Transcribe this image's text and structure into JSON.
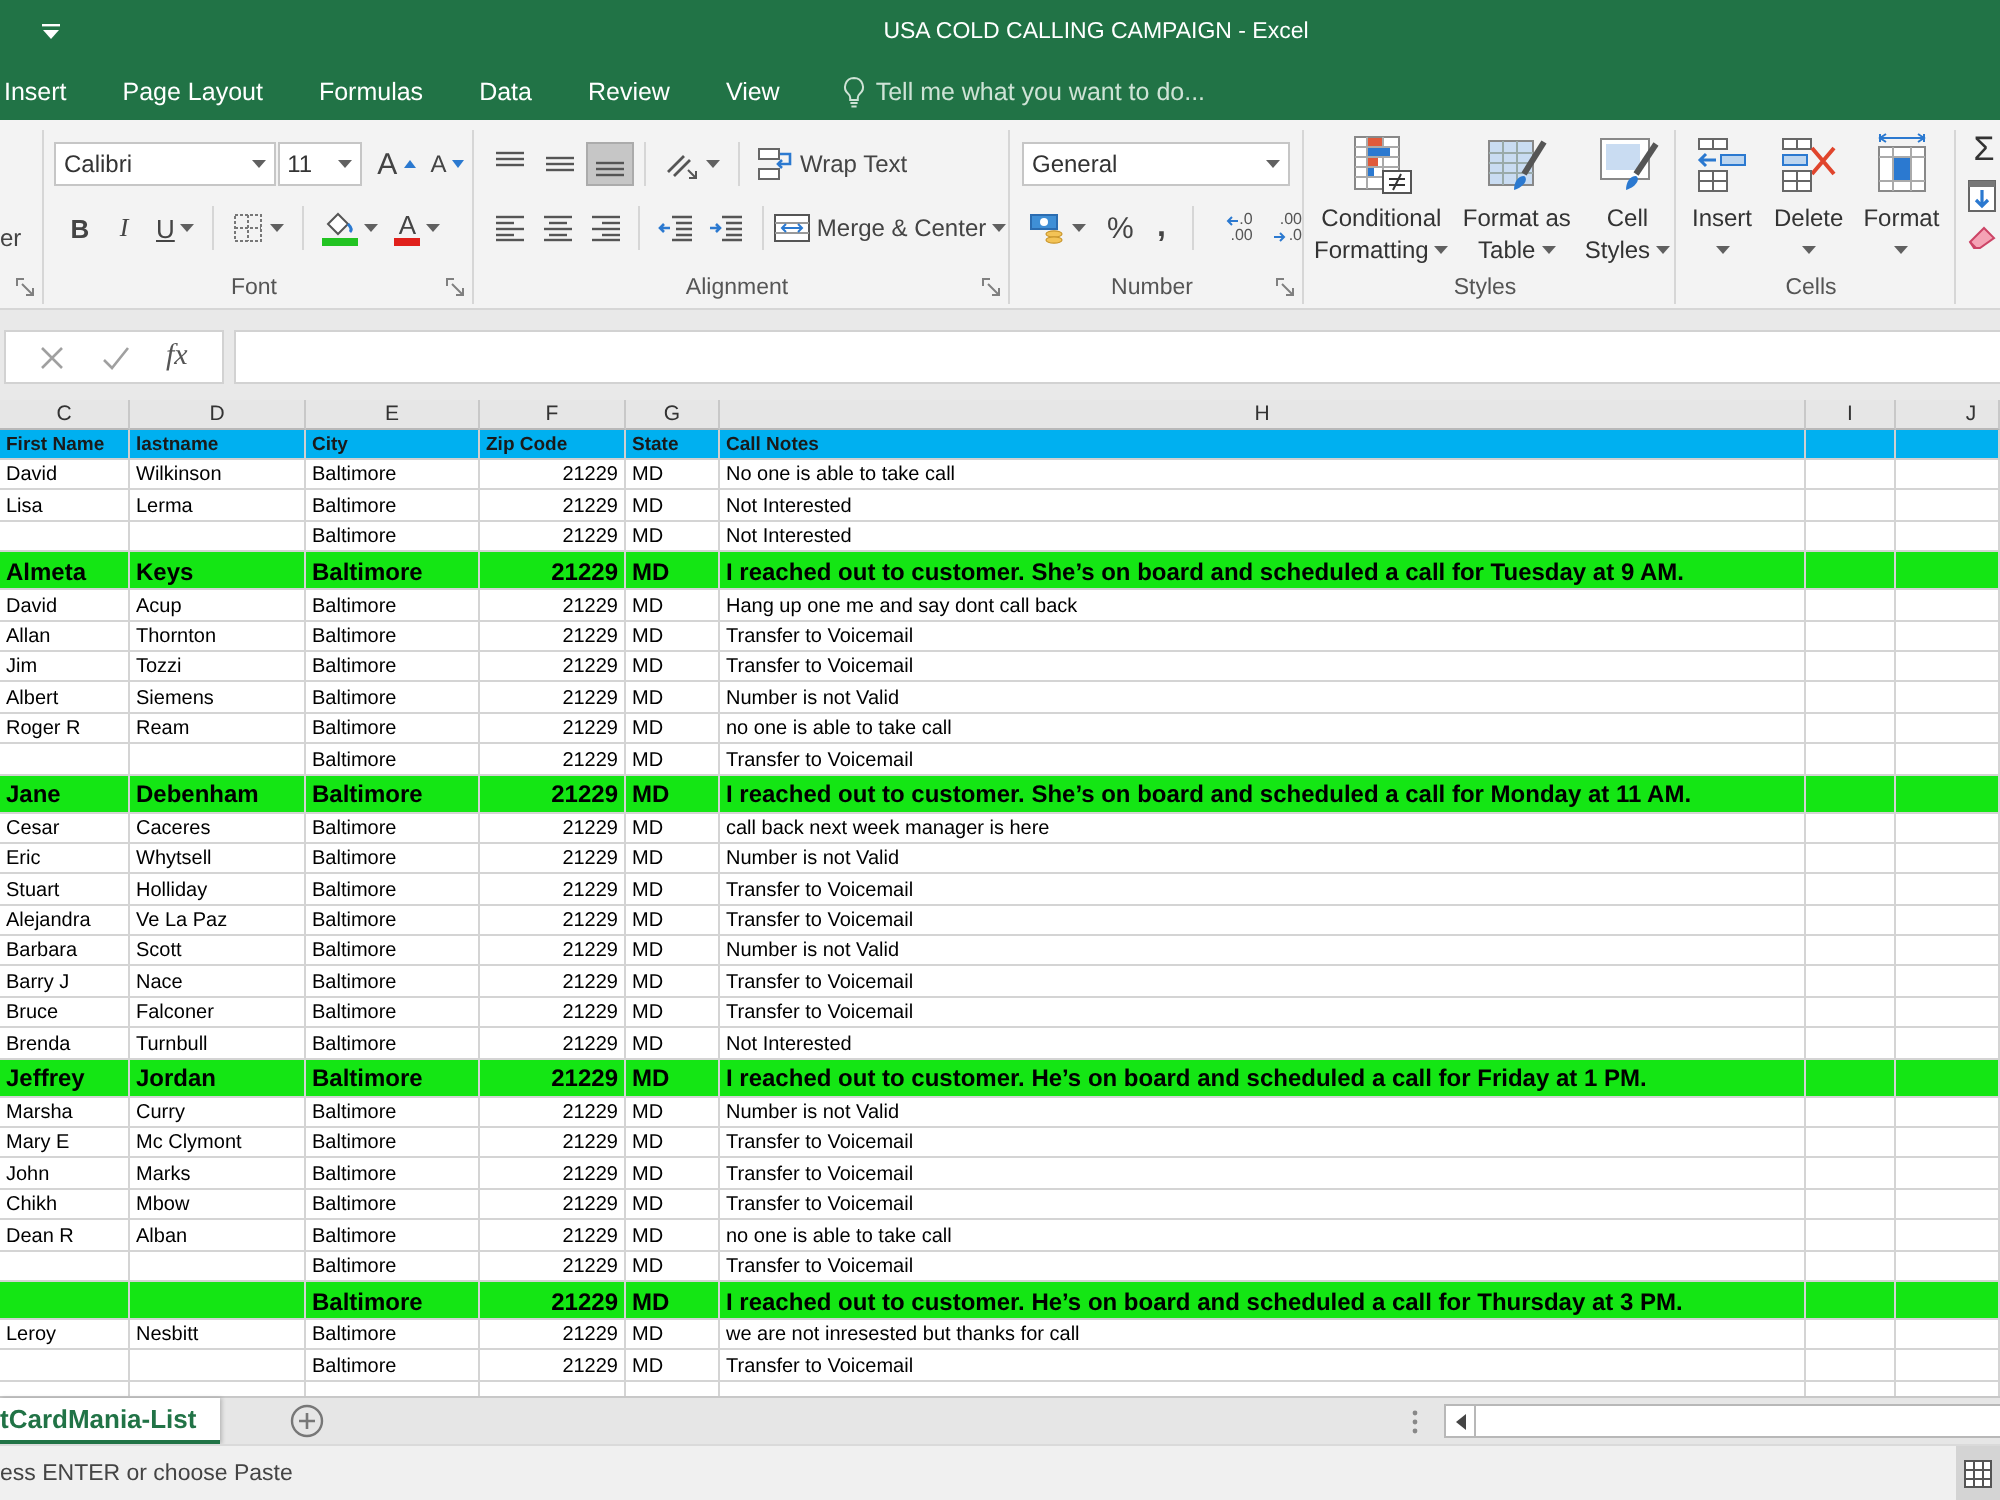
{
  "window": {
    "title": "USA COLD CALLING CAMPAIGN - Excel"
  },
  "menu_tabs": [
    {
      "label": "Insert"
    },
    {
      "label": "Page Layout"
    },
    {
      "label": "Formulas"
    },
    {
      "label": "Data"
    },
    {
      "label": "Review"
    },
    {
      "label": "View"
    }
  ],
  "tell_me": {
    "placeholder": "Tell me what you want to do..."
  },
  "ribbon": {
    "clipboard": {
      "label_fragment": "er"
    },
    "font": {
      "label": "Font",
      "font_name": "Calibri",
      "font_size": "11",
      "grow": "A",
      "shrink": "A",
      "styles": [
        {
          "kind": "bold",
          "label": "B"
        },
        {
          "kind": "italic",
          "label": "I"
        },
        {
          "kind": "underline",
          "label": "U"
        }
      ],
      "font_color": "A"
    },
    "alignment": {
      "label": "Alignment",
      "vertical": [
        {
          "kind": "top",
          "selected": false
        },
        {
          "kind": "middle",
          "selected": false
        },
        {
          "kind": "bottom",
          "selected": true
        }
      ],
      "horizontal": [
        {
          "kind": "left",
          "selected": false
        },
        {
          "kind": "center",
          "selected": false
        },
        {
          "kind": "right",
          "selected": false
        }
      ],
      "wrap_text": "Wrap Text",
      "merge": "Merge & Center"
    },
    "number": {
      "label": "Number",
      "format": "General",
      "percent": "%",
      "comma": ",",
      "decimals": [
        {
          "kind": "increase",
          "top": ".0",
          "bottom": ".00"
        },
        {
          "kind": "decrease",
          "top": ".00",
          "bottom": ".0"
        }
      ]
    },
    "styles": {
      "label": "Styles",
      "buttons": [
        {
          "kind": "conditional",
          "lines": [
            "Conditional",
            "Formatting"
          ]
        },
        {
          "kind": "table",
          "lines": [
            "Format as",
            "Table"
          ]
        },
        {
          "kind": "cell",
          "lines": [
            "Cell",
            "Styles"
          ]
        }
      ]
    },
    "cells": {
      "label": "Cells",
      "buttons": [
        {
          "kind": "insert",
          "label": "Insert"
        },
        {
          "kind": "delete",
          "label": "Delete"
        },
        {
          "kind": "format",
          "label": "Format"
        }
      ]
    },
    "editing": {
      "autosum": "Σ"
    }
  },
  "formula_bar": {
    "function_button": "fx"
  },
  "column_letters": [
    "C",
    "D",
    "E",
    "F",
    "G",
    "H",
    "I",
    "J"
  ],
  "table": {
    "columns": [
      "First Name",
      "lastname",
      "City",
      "Zip Code",
      "State",
      "Call Notes"
    ],
    "rows": [
      {
        "first_name": "David",
        "last_name": "Wilkinson",
        "city": "Baltimore",
        "zip": "21229",
        "state": "MD",
        "notes": "No one is able to take call",
        "highlighted": false
      },
      {
        "first_name": "Lisa",
        "last_name": "Lerma",
        "city": "Baltimore",
        "zip": "21229",
        "state": "MD",
        "notes": "Not Interested",
        "highlighted": false
      },
      {
        "city": "Baltimore",
        "zip": "21229",
        "state": "MD",
        "notes": "Not Interested",
        "highlighted": false
      },
      {
        "first_name": "Almeta",
        "last_name": "Keys",
        "city": "Baltimore",
        "zip": "21229",
        "state": "MD",
        "notes": "I reached out to customer. She’s on board and scheduled a call for Tuesday at 9 AM.",
        "highlighted": true
      },
      {
        "first_name": "David",
        "last_name": "Acup",
        "city": "Baltimore",
        "zip": "21229",
        "state": "MD",
        "notes": "Hang up one me and say dont call back",
        "highlighted": false
      },
      {
        "first_name": "Allan",
        "last_name": "Thornton",
        "city": "Baltimore",
        "zip": "21229",
        "state": "MD",
        "notes": "Transfer to Voicemail",
        "highlighted": false
      },
      {
        "first_name": "Jim",
        "last_name": "Tozzi",
        "city": "Baltimore",
        "zip": "21229",
        "state": "MD",
        "notes": "Transfer to Voicemail",
        "highlighted": false
      },
      {
        "first_name": "Albert",
        "last_name": "Siemens",
        "city": "Baltimore",
        "zip": "21229",
        "state": "MD",
        "notes": "Number is not Valid",
        "highlighted": false
      },
      {
        "first_name": "Roger R",
        "last_name": "Ream",
        "city": "Baltimore",
        "zip": "21229",
        "state": "MD",
        "notes": "no one is able to take call",
        "highlighted": false
      },
      {
        "city": "Baltimore",
        "zip": "21229",
        "state": "MD",
        "notes": "Transfer to Voicemail",
        "highlighted": false
      },
      {
        "first_name": "Jane",
        "last_name": "Debenham",
        "city": "Baltimore",
        "zip": "21229",
        "state": "MD",
        "notes": "I reached out to customer. She’s on board and scheduled a call for Monday at 11 AM.",
        "highlighted": true
      },
      {
        "first_name": "Cesar",
        "last_name": "Caceres",
        "city": "Baltimore",
        "zip": "21229",
        "state": "MD",
        "notes": "call back next week manager is here",
        "highlighted": false
      },
      {
        "first_name": "Eric",
        "last_name": "Whytsell",
        "city": "Baltimore",
        "zip": "21229",
        "state": "MD",
        "notes": "Number is not Valid",
        "highlighted": false
      },
      {
        "first_name": "Stuart",
        "last_name": "Holliday",
        "city": "Baltimore",
        "zip": "21229",
        "state": "MD",
        "notes": "Transfer to Voicemail",
        "highlighted": false
      },
      {
        "first_name": "Alejandra",
        "last_name": "Ve La Paz",
        "city": "Baltimore",
        "zip": "21229",
        "state": "MD",
        "notes": "Transfer to Voicemail",
        "highlighted": false
      },
      {
        "first_name": "Barbara",
        "last_name": "Scott",
        "city": "Baltimore",
        "zip": "21229",
        "state": "MD",
        "notes": "Number is not Valid",
        "highlighted": false
      },
      {
        "first_name": "Barry J",
        "last_name": "Nace",
        "city": "Baltimore",
        "zip": "21229",
        "state": "MD",
        "notes": "Transfer to Voicemail",
        "highlighted": false
      },
      {
        "first_name": "Bruce",
        "last_name": "Falconer",
        "city": "Baltimore",
        "zip": "21229",
        "state": "MD",
        "notes": "Transfer to Voicemail",
        "highlighted": false
      },
      {
        "first_name": "Brenda",
        "last_name": "Turnbull",
        "city": "Baltimore",
        "zip": "21229",
        "state": "MD",
        "notes": "Not Interested",
        "highlighted": false
      },
      {
        "first_name": "Jeffrey",
        "last_name": "Jordan",
        "city": "Baltimore",
        "zip": "21229",
        "state": "MD",
        "notes": "I reached out to customer. He’s on board and scheduled a call for Friday at 1 PM.",
        "highlighted": true
      },
      {
        "first_name": "Marsha",
        "last_name": "Curry",
        "city": "Baltimore",
        "zip": "21229",
        "state": "MD",
        "notes": "Number is not Valid",
        "highlighted": false
      },
      {
        "first_name": "Mary E",
        "last_name": "Mc Clymont",
        "city": "Baltimore",
        "zip": "21229",
        "state": "MD",
        "notes": "Transfer to Voicemail",
        "highlighted": false
      },
      {
        "first_name": "John",
        "last_name": "Marks",
        "city": "Baltimore",
        "zip": "21229",
        "state": "MD",
        "notes": "Transfer to Voicemail",
        "highlighted": false
      },
      {
        "first_name": "Chikh",
        "last_name": "Mbow",
        "city": "Baltimore",
        "zip": "21229",
        "state": "MD",
        "notes": "Transfer to Voicemail",
        "highlighted": false
      },
      {
        "first_name": "Dean R",
        "last_name": "Alban",
        "city": "Baltimore",
        "zip": "21229",
        "state": "MD",
        "notes": "no one is able to take call",
        "highlighted": false
      },
      {
        "city": "Baltimore",
        "zip": "21229",
        "state": "MD",
        "notes": "Transfer to Voicemail",
        "highlighted": false
      },
      {
        "city": "Baltimore",
        "zip": "21229",
        "state": "MD",
        "notes": "I reached out to customer. He’s on board and scheduled a call for Thursday at 3 PM.",
        "highlighted": true
      },
      {
        "first_name": "Leroy",
        "last_name": "Nesbitt",
        "city": "Baltimore",
        "zip": "21229",
        "state": "MD",
        "notes": "we are not inresested but thanks for call",
        "highlighted": false
      },
      {
        "city": "Baltimore",
        "zip": "21229",
        "state": "MD",
        "notes": "Transfer to Voicemail",
        "highlighted": false
      }
    ]
  },
  "sheet_tabs": [
    {
      "label": "tCardMania-List",
      "selected": true
    }
  ],
  "status_bar": {
    "message": "ess ENTER or choose Paste"
  }
}
